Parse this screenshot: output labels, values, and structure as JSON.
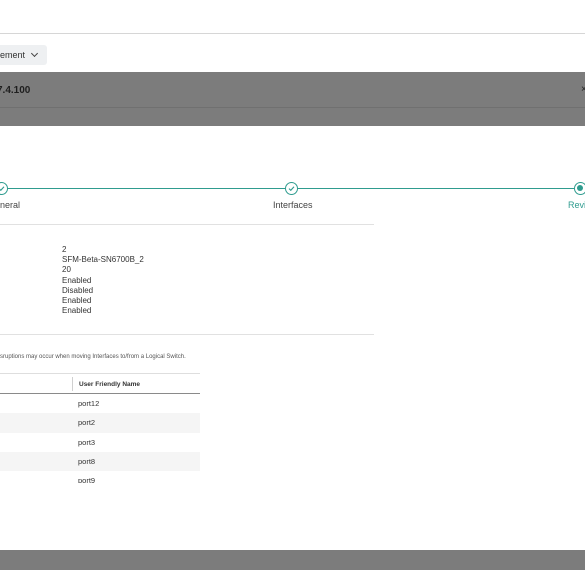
{
  "filter": {
    "label": "ement"
  },
  "modal": {
    "title": "7.4.100",
    "close": "×"
  },
  "steps": [
    {
      "label": "neral",
      "state": "completed"
    },
    {
      "label": "Interfaces",
      "state": "completed"
    },
    {
      "label": "Revi",
      "state": "current"
    }
  ],
  "summary": {
    "values": [
      "2",
      "SFM-Beta-SN6700B_2",
      "20",
      "Enabled",
      "Disabled",
      "Enabled",
      "Enabled"
    ]
  },
  "interfaces": {
    "note": "sruptions may occur when moving Interfaces to/from a Logical Switch.",
    "column_user_friendly_name": "User Friendly Name",
    "rows": [
      "port12",
      "port2",
      "port3",
      "port8",
      "port9"
    ]
  },
  "colors": {
    "accent": "#2f9c8f",
    "overlay": "#7c7c7c"
  }
}
